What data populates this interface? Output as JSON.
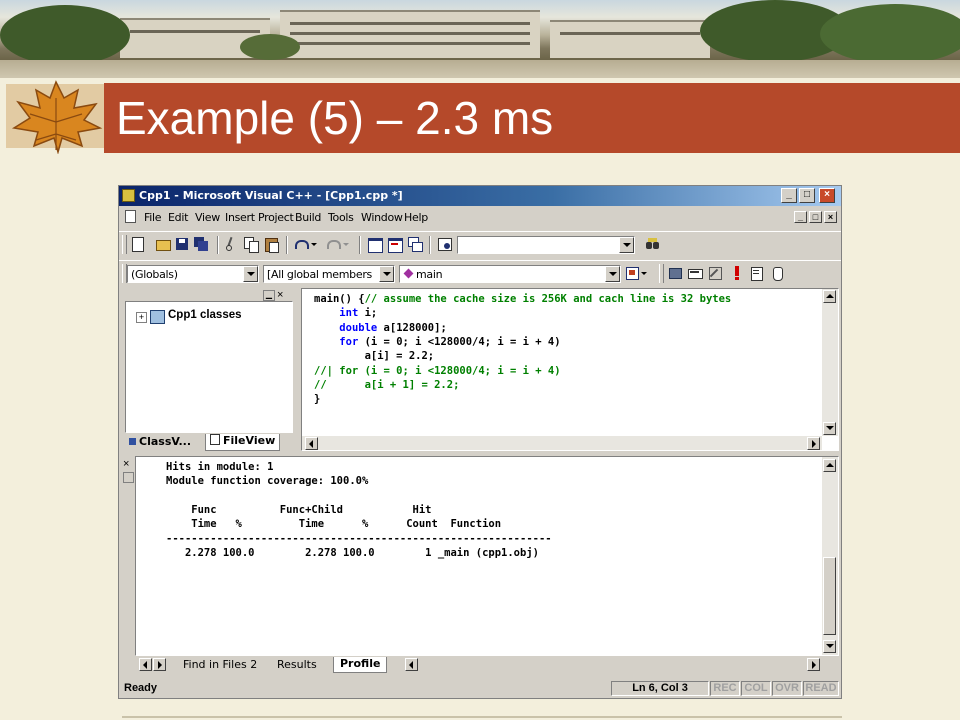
{
  "slide": {
    "title": "Example (5) – 2.3 ms"
  },
  "window": {
    "title": "Cpp1 - Microsoft Visual C++ - [Cpp1.cpp *]",
    "buttons": {
      "minimize": "_",
      "maximize": "□",
      "close": "×"
    }
  },
  "menubar": {
    "items": [
      "File",
      "Edit",
      "View",
      "Insert",
      "Project",
      "Build",
      "Tools",
      "Window",
      "Help"
    ],
    "mdi": {
      "minimize": "_",
      "restore": "□",
      "close": "×"
    }
  },
  "toolbar2": {
    "scope_combo": "(Globals)",
    "members_combo": "[All global members",
    "function_combo": "main"
  },
  "workspace": {
    "tree_root": "Cpp1 classes",
    "tree_expander": "+",
    "tabs": [
      "ClassV...",
      "FileView"
    ]
  },
  "editor": {
    "lines": [
      [
        {
          "t": "tx",
          "v": "main() {"
        },
        {
          "t": "cm",
          "v": "// assume the cache size is 256K and cach line is 32 bytes"
        }
      ],
      [
        {
          "t": "tx",
          "v": "    "
        },
        {
          "t": "kw",
          "v": "int"
        },
        {
          "t": "tx",
          "v": " i;"
        }
      ],
      [
        {
          "t": "tx",
          "v": "    "
        },
        {
          "t": "kw",
          "v": "double"
        },
        {
          "t": "tx",
          "v": " a[128000];"
        }
      ],
      [
        {
          "t": "tx",
          "v": "    "
        },
        {
          "t": "kw",
          "v": "for"
        },
        {
          "t": "tx",
          "v": " (i = 0; i <128000/4; i = i + 4)"
        }
      ],
      [
        {
          "t": "tx",
          "v": "        a[i] = 2.2;"
        }
      ],
      [
        {
          "t": "cm",
          "v": "//| for (i = 0; i <128000/4; i = i + 4)"
        }
      ],
      [
        {
          "t": "cm",
          "v": "//      a[i + 1] = 2.2;"
        }
      ],
      [
        {
          "t": "tx",
          "v": "}"
        }
      ]
    ]
  },
  "output": {
    "lines": [
      "Hits in module: 1",
      "Module function coverage: 100.0%",
      "",
      "    Func          Func+Child           Hit",
      "    Time   %         Time      %      Count  Function",
      "-------------------------------------------------------------",
      "   2.278 100.0        2.278 100.0        1 _main (cpp1.obj)"
    ],
    "tabs": [
      "Find in Files 2",
      "Results",
      "Profile"
    ]
  },
  "statusbar": {
    "ready": "Ready",
    "position": "Ln 6, Col 3",
    "indicators": [
      "REC",
      "COL",
      "OVR",
      "READ"
    ]
  }
}
